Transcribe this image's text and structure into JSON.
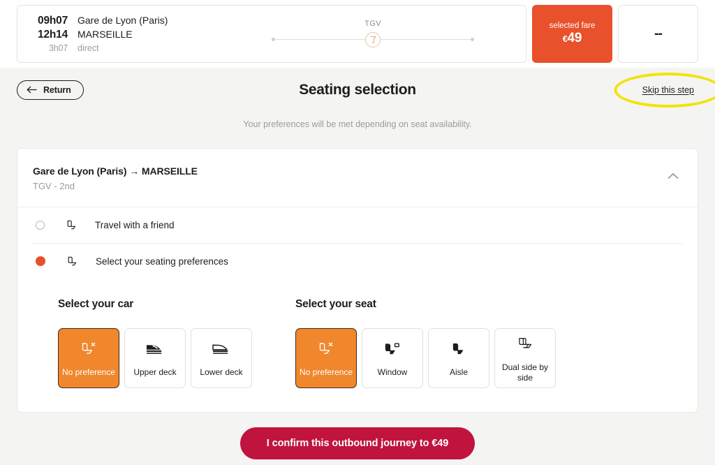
{
  "journey_strip": {
    "departure_time": "09h07",
    "departure_station": "Gare de Lyon (Paris)",
    "arrival_time": "12h14",
    "arrival_station": "MARSEILLE",
    "duration": "3h07",
    "stops": "direct",
    "train_type": "TGV",
    "onboard_icon": "bar-service-icon",
    "fare": {
      "label": "selected fare",
      "currency": "€",
      "amount": "49",
      "color": "#e8512b"
    },
    "return_fare_placeholder": "--"
  },
  "header": {
    "return_label": "Return",
    "back_arrow_icon": "arrow-left-icon",
    "title": "Seating selection",
    "skip_label": "Skip this step",
    "annotation_color": "#f0e400",
    "subtitle": "Your preferences will be met depending on seat availability."
  },
  "leg_card": {
    "title": "Gare de Lyon (Paris) → MARSEILLE",
    "subtitle": "TGV - 2nd",
    "collapse_icon": "chevron-up-icon",
    "collapse_icon_color": "#b08878",
    "options": [
      {
        "label": "Travel with a friend",
        "selected": false,
        "icon": "seat-icon"
      },
      {
        "label": "Select your seating preferences",
        "selected": true,
        "icon": "seat-icon"
      }
    ],
    "selected_radio_color": "#e8502a"
  },
  "preferences": {
    "selected_tile_color": "#f0872c",
    "car": {
      "title": "Select your car",
      "tiles": [
        {
          "label": "No preference",
          "icon": "seat-no-preference-icon",
          "selected": true
        },
        {
          "label": "Upper deck",
          "icon": "train-upper-deck-icon",
          "selected": false
        },
        {
          "label": "Lower deck",
          "icon": "train-lower-deck-icon",
          "selected": false
        }
      ]
    },
    "seat": {
      "title": "Select your seat",
      "tiles": [
        {
          "label": "No preference",
          "icon": "seat-no-preference-icon",
          "selected": true
        },
        {
          "label": "Window",
          "icon": "seat-window-icon",
          "selected": false
        },
        {
          "label": "Aisle",
          "icon": "seat-aisle-icon",
          "selected": false
        },
        {
          "label": "Dual side by side",
          "icon": "seat-dual-side-icon",
          "selected": false
        }
      ]
    }
  },
  "confirm": {
    "label": "I confirm this outbound journey to €49",
    "color": "#c0143f"
  }
}
